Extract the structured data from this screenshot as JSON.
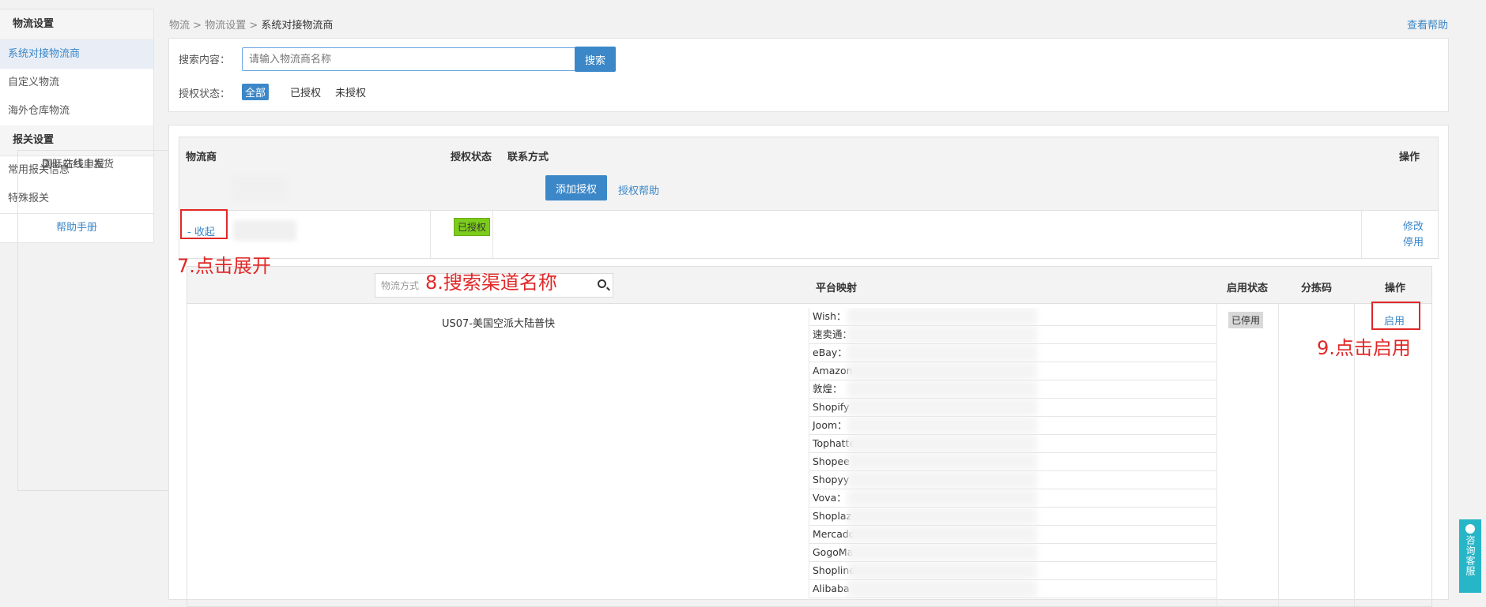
{
  "sidebar": {
    "groups": [
      {
        "title": "物流设置",
        "items": [
          "系统对接物流商",
          "自定义物流",
          "海外仓库物流"
        ]
      },
      {
        "title": "报关设置",
        "items": [
          "常用报关信息",
          "特殊报关"
        ],
        "subitems": [
          "国际站线上发货",
          "DHL在线申报"
        ]
      }
    ],
    "help": "帮助手册"
  },
  "breadcrumb": {
    "items": [
      "物流",
      "物流设置"
    ],
    "current": "系统对接物流商",
    "sep": ">"
  },
  "top_help": "查看帮助",
  "search": {
    "label": "搜索内容：",
    "placeholder": "请输入物流商名称",
    "button": "搜索",
    "auth_label": "授权状态：",
    "auth_options": [
      "全部",
      "已授权",
      "未授权"
    ]
  },
  "table": {
    "headers": [
      "物流商",
      "授权状态",
      "联系方式",
      "操作"
    ],
    "add_button": "添加授权",
    "auth_help": "授权帮助",
    "provider_row": {
      "toggle": "- 收起",
      "status": "已授权",
      "ops": [
        "修改",
        "停用"
      ]
    }
  },
  "channel_table": {
    "search_placeholder": "物流方式",
    "headers": [
      "平台映射",
      "启用状态",
      "分拣码",
      "操作"
    ],
    "channel_name": "US07-美国空派大陆普快",
    "platforms": [
      "Wish：",
      "速卖通：",
      "eBay：",
      "Amazon",
      "敦煌：",
      "Shopify",
      "Joom：",
      "Tophatte",
      "Shopee",
      "Shopyy",
      "Vova：",
      "Shoplaz",
      "Mercado",
      "GogoMa",
      "Shopline",
      "Alibaba"
    ],
    "status": "已停用",
    "action": "启用"
  },
  "annotations": {
    "step7": "7.点击展开",
    "step8": "8.搜索渠道名称",
    "step9": "9.点击启用"
  },
  "float_service": "咨询客服",
  "colors": {
    "accent": "#3b87c8",
    "annotation": "#e02828",
    "authorized": "#7ccd1b",
    "service": "#27b6c7"
  }
}
